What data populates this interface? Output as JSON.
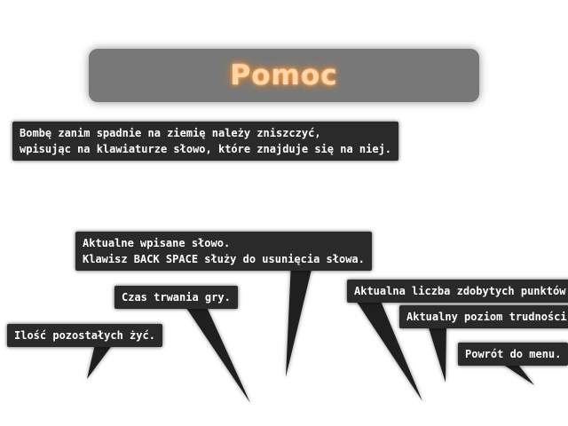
{
  "title": "Pomoc",
  "bubbles": {
    "instructions": [
      "Bombę zanim spadnie na ziemię należy zniszczyć,",
      "wpisując na klawiaturze słowo, które znajduje się na niej."
    ],
    "current_word": [
      "Aktualne wpisane słowo.",
      "Klawisz BACK SPACE służy do usunięcia słowa."
    ],
    "game_time": "Czas trwania gry.",
    "lives": "Ilość pozostałych żyć.",
    "score": "Aktualna liczba zdobytych punktów.",
    "difficulty": "Aktualny poziom trudności.",
    "menu_return": "Powrót do menu."
  }
}
